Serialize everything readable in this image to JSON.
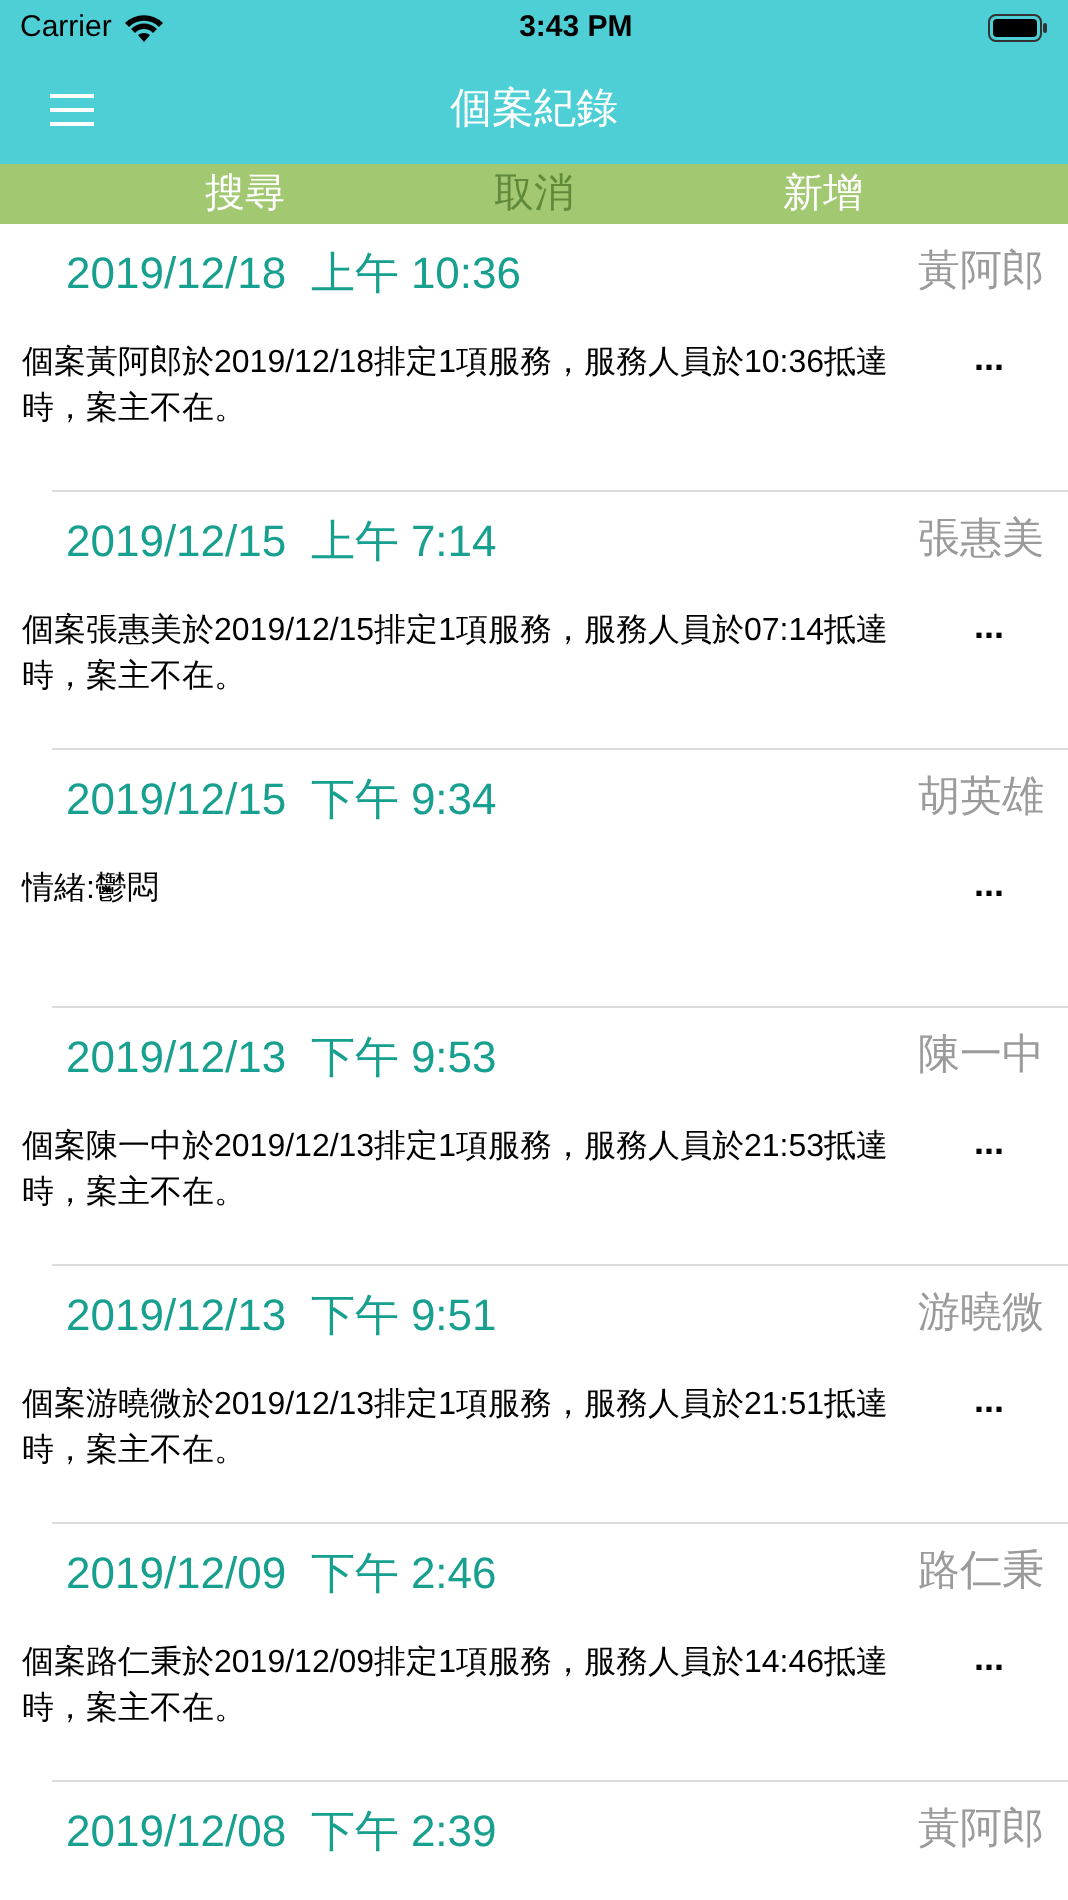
{
  "status_bar": {
    "carrier": "Carrier",
    "time": "3:43 PM"
  },
  "nav_bar": {
    "title": "個案紀錄"
  },
  "toolbar": [
    {
      "label": "搜尋",
      "disabled": false
    },
    {
      "label": "取消",
      "disabled": true
    },
    {
      "label": "新增",
      "disabled": false
    }
  ],
  "records": [
    {
      "datetime": "2019/12/18  上午 10:36",
      "name": "黃阿郎",
      "note": "個案黃阿郎於2019/12/18排定1項服務，服務人員於10:36抵達時，案主不在。",
      "more": "..."
    },
    {
      "datetime": "2019/12/15  上午 7:14",
      "name": "張惠美",
      "note": "個案張惠美於2019/12/15排定1項服務，服務人員於07:14抵達時，案主不在。",
      "more": "..."
    },
    {
      "datetime": "2019/12/15  下午 9:34",
      "name": "胡英雄",
      "note": "情緒:鬱悶",
      "more": "..."
    },
    {
      "datetime": "2019/12/13  下午 9:53",
      "name": "陳一中",
      "note": "個案陳一中於2019/12/13排定1項服務，服務人員於21:53抵達時，案主不在。",
      "more": "..."
    },
    {
      "datetime": "2019/12/13  下午 9:51",
      "name": "游曉微",
      "note": "個案游曉微於2019/12/13排定1項服務，服務人員於21:51抵達時，案主不在。",
      "more": "..."
    },
    {
      "datetime": "2019/12/09  下午 2:46",
      "name": "路仁秉",
      "note": "個案路仁秉於2019/12/09排定1項服務，服務人員於14:46抵達時，案主不在。",
      "more": "..."
    },
    {
      "datetime": "2019/12/08  下午 2:39",
      "name": "黃阿郎"
    }
  ]
}
